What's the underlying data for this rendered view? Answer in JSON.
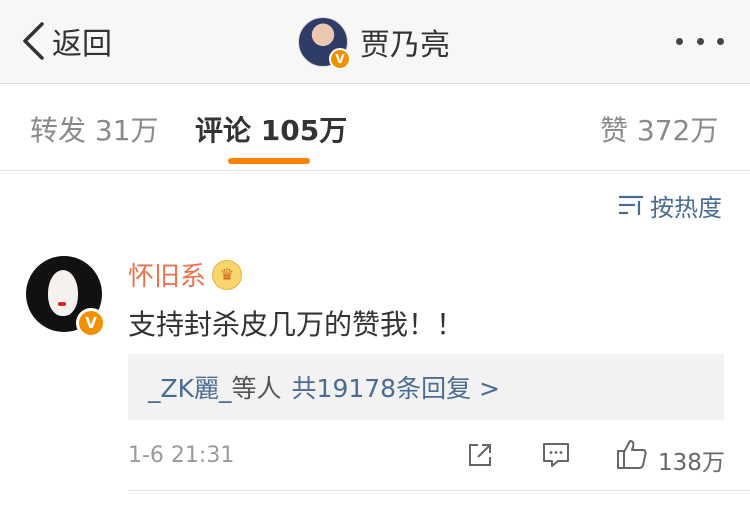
{
  "nav": {
    "back_label": "返回",
    "title": "贾乃亮",
    "verified_badge": "V"
  },
  "tabs": [
    {
      "label": "转发 31万",
      "active": false
    },
    {
      "label": "评论 105万",
      "active": true
    },
    {
      "label": "赞 372万",
      "active": false
    }
  ],
  "sort": {
    "label": "按热度",
    "icon": "sort-lines-icon"
  },
  "comment": {
    "username": "怀旧系",
    "crown_icon": "crown-icon",
    "verified_badge": "V",
    "text": "支持封杀皮几万的赞我！！",
    "replies": {
      "replier": "_ZK麗_",
      "middle": "等人",
      "count_link": "共19178条回复 >"
    },
    "timestamp": "1-6 21:31",
    "like_count": "138万"
  },
  "colors": {
    "accent_orange": "#ff8200",
    "username": "#eb7350",
    "link_blue": "#4a6b94",
    "badge": "#f29100"
  }
}
